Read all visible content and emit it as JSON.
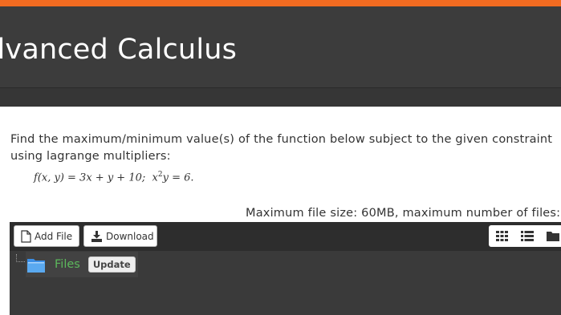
{
  "header": {
    "title": "dvanced Calculus"
  },
  "question": {
    "text": "Find the maximum/minimum value(s) of the function below subject to the given constraint using lagrange multipliers:",
    "formula": {
      "f": "f(x, y) = 3x + y + 10;",
      "constraint_pre": "x",
      "constraint_sup": "2",
      "constraint_post": "y = 6."
    }
  },
  "upload": {
    "max_info": "Maximum file size: 60MB, maximum number of files:",
    "buttons": {
      "add_file": "Add File",
      "download": "Download"
    },
    "views": [
      "grid-view-icon",
      "list-view-icon",
      "folder-view-icon"
    ],
    "tree": {
      "folder_label": "Files",
      "update_label": "Update"
    }
  },
  "colors": {
    "accent": "#f26b21",
    "header_bg": "#3c3c3c",
    "files_green": "#5cb85c"
  }
}
